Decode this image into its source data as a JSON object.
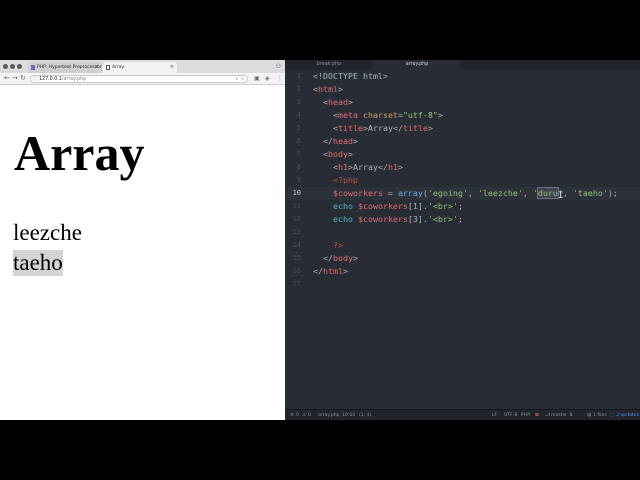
{
  "browser": {
    "tabs": [
      {
        "title": "PHP: Hypertext Preprocessor",
        "icon": "php-icon"
      },
      {
        "title": "Array",
        "icon": "page-icon"
      }
    ],
    "address": {
      "host": "127.0.0.1",
      "path": "/array.php"
    },
    "page": {
      "heading": "Array",
      "lines": [
        "leezche",
        "taeho"
      ]
    }
  },
  "editor": {
    "tabs": [
      "break.php",
      "array.php"
    ],
    "active_tab": 1,
    "line_numbers": [
      "1",
      "2",
      "3",
      "4",
      "5",
      "6",
      "7",
      "8",
      "9",
      "10",
      "11",
      "12",
      "13",
      "14",
      "15",
      "16",
      "17"
    ],
    "current_line": "10",
    "code": {
      "l1": "<!DOCTYPE html>",
      "l2_open": "<",
      "l2_tag": "html",
      "l2_close": ">",
      "l3_indent": "  ",
      "l3_open": "<",
      "l3_tag": "head",
      "l3_close": ">",
      "l4_indent": "    ",
      "l4_open": "<",
      "l4_tag": "meta",
      "l4_attr": " charset",
      "l4_eq": "=",
      "l4_val": "\"utf-8\"",
      "l4_close": ">",
      "l5_indent": "    ",
      "l5_open": "<",
      "l5_tag": "title",
      "l5_gt": ">",
      "l5_text": "Array",
      "l5_end_open": "</",
      "l5_end_tag": "title",
      "l5_close": ">",
      "l6_indent": "  ",
      "l6_open": "</",
      "l6_tag": "head",
      "l6_close": ">",
      "l7_indent": "  ",
      "l7_open": "<",
      "l7_tag": "body",
      "l7_close": ">",
      "l8_indent": "    ",
      "l8_open": "<",
      "l8_tag": "h1",
      "l8_gt": ">",
      "l8_text": "Array",
      "l8_end_open": "</",
      "l8_end_tag": "h1",
      "l8_close": ">",
      "l9_indent": "    ",
      "l9_php": "<?php",
      "l10_indent": "    ",
      "l10_var": "$coworkers",
      "l10_eq": " = ",
      "l10_fn": "array",
      "l10_p1": "(",
      "l10_s1": "'egoing'",
      "l10_c1": ", ",
      "l10_s2": "'leezche'",
      "l10_c2": ", ",
      "l10_q1": "'",
      "l10_sel": "duru",
      "l10_q2": "'",
      "l10_c3": ", ",
      "l10_s4": "'taeho'",
      "l10_end": ");",
      "l11_indent": "    ",
      "l11_kw": "echo",
      "l11_sp": " ",
      "l11_var": "$coworkers",
      "l11_idx": "[1]",
      "l11_dot": ".",
      "l11_str": "'<br>'",
      "l11_end": ";",
      "l12_indent": "    ",
      "l12_kw": "echo",
      "l12_sp": " ",
      "l12_var": "$coworkers",
      "l12_idx": "[3]",
      "l12_dot": ".",
      "l12_str": "'<br>'",
      "l12_end": ";",
      "l14_indent": "    ",
      "l14_php": "?>",
      "l15_indent": "  ",
      "l15_open": "</",
      "l15_tag": "body",
      "l15_close": ">",
      "l16_open": "</",
      "l16_tag": "html",
      "l16_close": ">"
    },
    "status": {
      "problems": "0",
      "warnings": "0",
      "file": "array.php",
      "line_col": "10:60",
      "selection": "(1, 4)",
      "line_ending": "LF",
      "encoding": "UTF-8",
      "grammar": "PHP",
      "branch": "master",
      "files": "1 files",
      "updates": "3 updates"
    }
  },
  "colors": {
    "editor_bg": "#282c34",
    "tag": "#e06c75",
    "string": "#98c379",
    "attr": "#d19a66",
    "function": "#61afef",
    "keyword": "#56b6c2"
  }
}
